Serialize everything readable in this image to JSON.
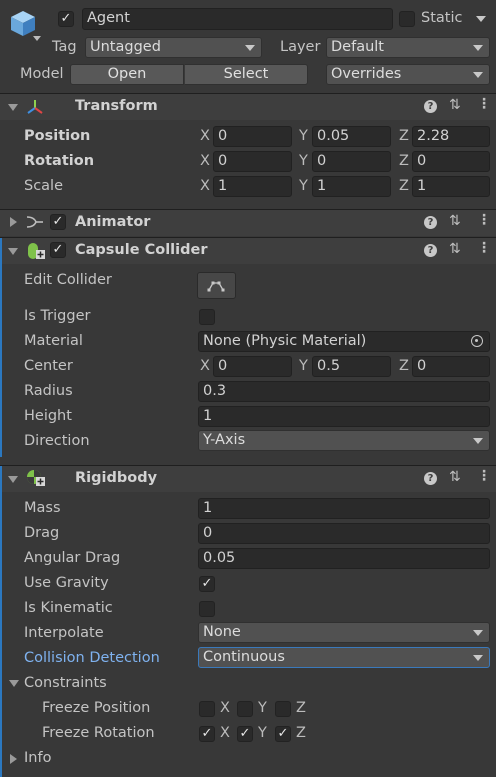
{
  "object": {
    "name": "Agent",
    "static_label": "Static",
    "tag_label": "Tag",
    "tag_value": "Untagged",
    "layer_label": "Layer",
    "layer_value": "Default",
    "model_label": "Model",
    "open_label": "Open",
    "select_label": "Select",
    "overrides_label": "Overrides"
  },
  "transform": {
    "title": "Transform",
    "position": {
      "label": "Position",
      "x": "0",
      "y": "0.05",
      "z": "2.28"
    },
    "rotation": {
      "label": "Rotation",
      "x": "0",
      "y": "0",
      "z": "0"
    },
    "scale": {
      "label": "Scale",
      "x": "1",
      "y": "1",
      "z": "1"
    }
  },
  "axis": {
    "x": "X",
    "y": "Y",
    "z": "Z"
  },
  "animator": {
    "title": "Animator"
  },
  "capsule": {
    "title": "Capsule Collider",
    "edit_collider": "Edit Collider",
    "is_trigger": "Is Trigger",
    "material_label": "Material",
    "material_value": "None (Physic Material)",
    "center_label": "Center",
    "center": {
      "x": "0",
      "y": "0.5",
      "z": "0"
    },
    "radius_label": "Radius",
    "radius": "0.3",
    "height_label": "Height",
    "height": "1",
    "direction_label": "Direction",
    "direction": "Y-Axis"
  },
  "rigidbody": {
    "title": "Rigidbody",
    "mass_label": "Mass",
    "mass": "1",
    "drag_label": "Drag",
    "drag": "0",
    "angular_drag_label": "Angular Drag",
    "angular_drag": "0.05",
    "use_gravity_label": "Use Gravity",
    "is_kinematic_label": "Is Kinematic",
    "interpolate_label": "Interpolate",
    "interpolate": "None",
    "collision_label": "Collision Detection",
    "collision": "Continuous",
    "constraints_label": "Constraints",
    "freeze_position_label": "Freeze Position",
    "freeze_rotation_label": "Freeze Rotation",
    "info_label": "Info"
  },
  "colors": {
    "accent_blue": "#2b78c0",
    "highlight_text": "#7fb2ef"
  }
}
